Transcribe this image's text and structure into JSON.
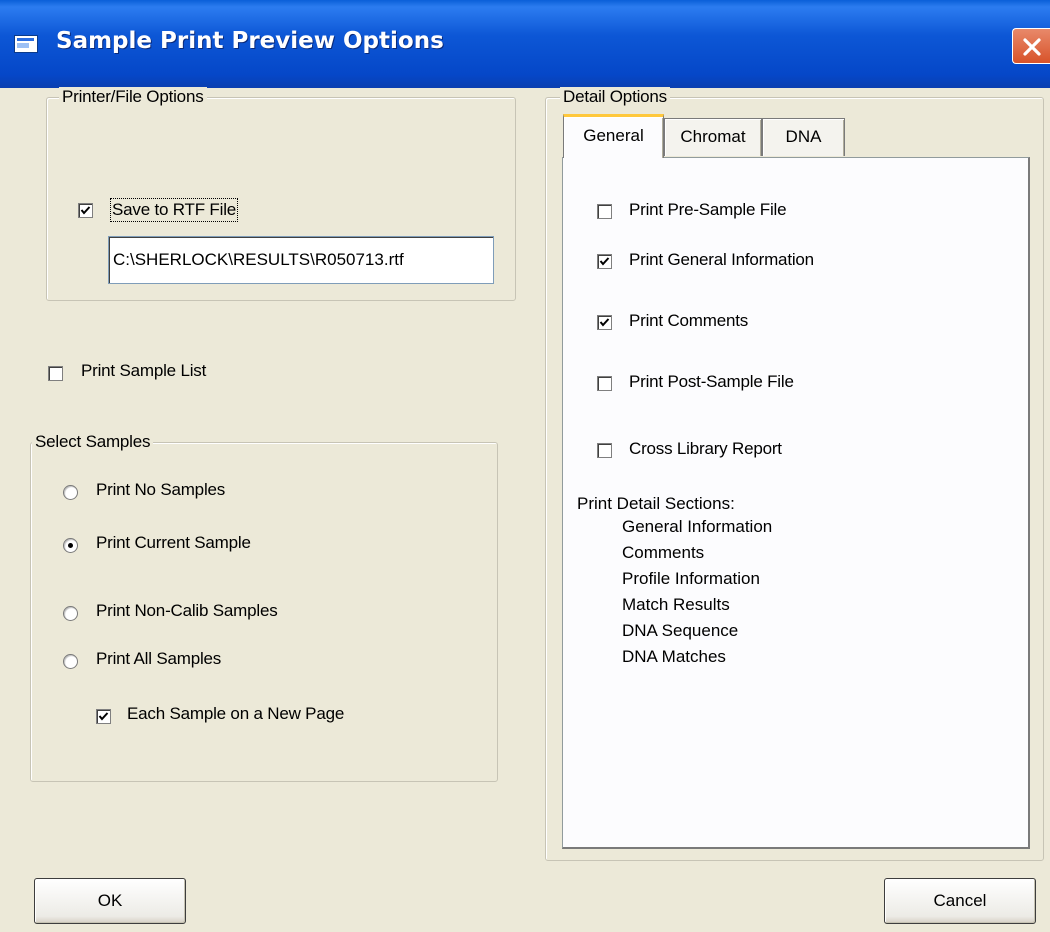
{
  "window": {
    "title": "Sample Print Preview Options"
  },
  "printer_file": {
    "legend": "Printer/File Options",
    "save_rtf_label": "Save to RTF File",
    "save_rtf_checked": true,
    "rtf_path": "C:\\SHERLOCK\\RESULTS\\R050713.rtf"
  },
  "print_sample_list": {
    "label": "Print Sample List",
    "checked": false
  },
  "select_samples": {
    "legend": "Select Samples",
    "options": [
      {
        "label": "Print No Samples",
        "selected": false
      },
      {
        "label": "Print Current Sample",
        "selected": true
      },
      {
        "label": "Print Non-Calib Samples",
        "selected": false
      },
      {
        "label": "Print All Samples",
        "selected": false
      }
    ],
    "each_new_page": {
      "label": "Each Sample on a New Page",
      "checked": true
    }
  },
  "detail": {
    "legend": "Detail Options",
    "tabs": [
      {
        "label": "General",
        "active": true
      },
      {
        "label": "Chromat",
        "active": false
      },
      {
        "label": "DNA",
        "active": false
      }
    ],
    "options": [
      {
        "label": "Print Pre-Sample File",
        "checked": false
      },
      {
        "label": "Print General Information",
        "checked": true
      },
      {
        "label": "Print Comments",
        "checked": true
      },
      {
        "label": "Print Post-Sample File",
        "checked": false
      },
      {
        "label": "Cross Library Report",
        "checked": false
      }
    ],
    "sections_title": "Print Detail Sections:",
    "sections": [
      "General Information",
      "Comments",
      "Profile Information",
      "Match Results",
      "DNA Sequence",
      "DNA Matches"
    ]
  },
  "buttons": {
    "ok": "OK",
    "cancel": "Cancel"
  }
}
